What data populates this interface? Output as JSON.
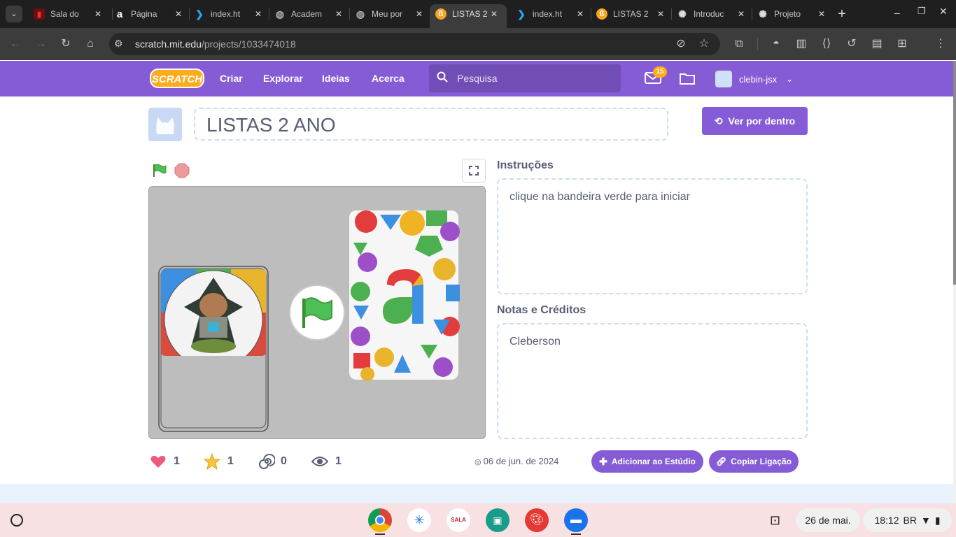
{
  "browser": {
    "tabs": [
      {
        "title": "Sala do",
        "icon": "red-square-icon",
        "active": false
      },
      {
        "title": "Página",
        "icon": "a-logo-icon",
        "active": false
      },
      {
        "title": "index.ht",
        "icon": "vscode-icon",
        "active": false
      },
      {
        "title": "Academ",
        "icon": "globe-icon",
        "active": false
      },
      {
        "title": "Meu por",
        "icon": "globe-icon",
        "active": false
      },
      {
        "title": "LISTAS 2",
        "icon": "scratch-icon",
        "active": true
      },
      {
        "title": "index.ht",
        "icon": "vscode-icon",
        "active": false
      },
      {
        "title": "LISTAS 2",
        "icon": "scratch-icon",
        "active": false
      },
      {
        "title": "Introduc",
        "icon": "openai-icon",
        "active": false
      },
      {
        "title": "Projeto",
        "icon": "openai-icon",
        "active": false
      }
    ],
    "url_host": "scratch.mit.edu",
    "url_path": "/projects/1033474018"
  },
  "nav": {
    "logo": "SCRATCH",
    "links": [
      "Criar",
      "Explorar",
      "Ideias",
      "Acerca"
    ],
    "search_placeholder": "Pesquisa",
    "messages_count": "15",
    "username": "clebin-jsx"
  },
  "project": {
    "title": "LISTAS 2 ANO",
    "see_inside": "Ver por dentro",
    "instructions_label": "Instruções",
    "instructions": "clique na bandeira verde para iniciar",
    "notes_label": "Notas e Créditos",
    "notes": "Cleberson",
    "stats": {
      "loves": "1",
      "favorites": "1",
      "remixes": "0",
      "views": "1"
    },
    "date": "06 de jun. de 2024",
    "add_studio": "Adicionar ao Estúdio",
    "copy_link": "Copiar Ligação"
  },
  "shelf": {
    "date": "26 de mai.",
    "time": "18:12",
    "locale": "BR"
  },
  "colors": {
    "scratch_purple": "#855cd6",
    "chrome_dark": "#1f1f1f",
    "toolbar": "#3c3c3c",
    "shelf_bg": "#f7e1e3"
  }
}
